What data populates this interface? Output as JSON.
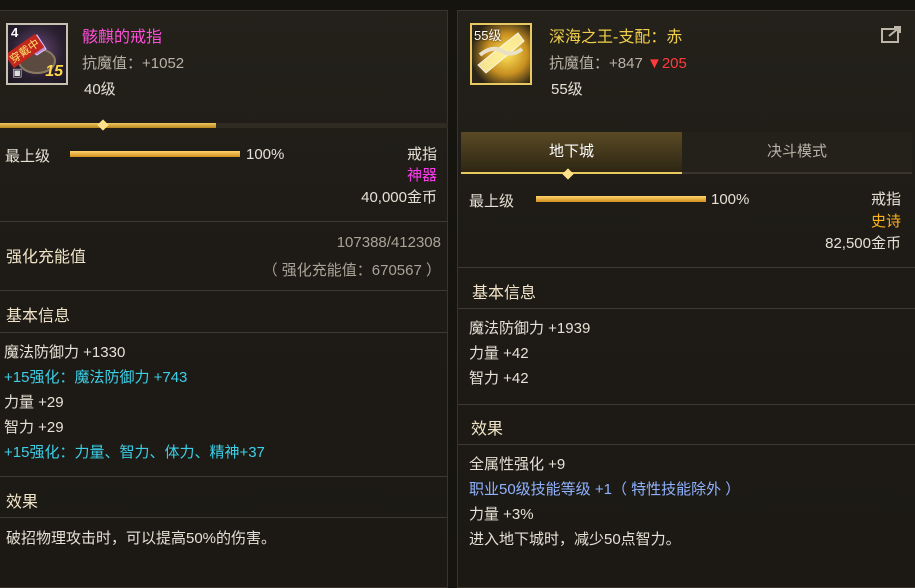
{
  "left": {
    "item_name": "骸麒的戒指",
    "item_name_color": "#ff4fd8",
    "badge_top": "4",
    "badge_equipped": "穿戴中",
    "badge_enhance": "15",
    "magic_resist": "抗魔值：+1052",
    "level": "40级",
    "max_level_label": "最上级",
    "max_level_pct": "100%",
    "max_level_fill": 1.0,
    "slot": "戒指",
    "rarity": "神器",
    "rarity_color": "#ff3bf0",
    "price": "40,000金币",
    "charge_label": "强化充能值",
    "charge_value": "107388/412308",
    "charge_sub": "（ 强化充能值：670567 ）",
    "basic_info_heading": "基本信息",
    "stats": [
      {
        "text": "魔法防御力 +1330",
        "color": "white"
      },
      {
        "text": "+15强化：魔法防御力 +743",
        "color": "cyan"
      },
      {
        "text": "力量 +29",
        "color": "white"
      },
      {
        "text": "智力 +29",
        "color": "white"
      },
      {
        "text": "+15强化：力量、智力、体力、精神+37",
        "color": "cyan"
      }
    ],
    "effect_heading": "效果",
    "effect_text": "破招物理攻击时，可以提高50%的伤害。"
  },
  "right": {
    "item_name": "深海之王-支配：赤",
    "item_name_color": "#f2cf4a",
    "badge_level": "55级",
    "magic_resist": "抗魔值：+847",
    "resist_diff": "▼205",
    "resist_diff_color": "#ff3b3b",
    "level": "55级",
    "share_icon": "share-icon",
    "tabs": [
      "地下城",
      "决斗模式"
    ],
    "active_tab": 0,
    "max_level_label": "最上级",
    "max_level_pct": "100%",
    "max_level_fill": 1.0,
    "slot": "戒指",
    "rarity": "史诗",
    "rarity_color": "#ffb21a",
    "price": "82,500金币",
    "basic_info_heading": "基本信息",
    "stats": [
      {
        "text": "魔法防御力 +1939",
        "color": "white"
      },
      {
        "text": "力量 +42",
        "color": "white"
      },
      {
        "text": "智力 +42",
        "color": "white"
      }
    ],
    "effect_heading": "效果",
    "effects": [
      {
        "text": "全属性强化 +9",
        "color": "white"
      },
      {
        "text": "职业50级技能等级 +1（ 特性技能除外 ）",
        "color": "blue"
      },
      {
        "text": "力量 +3%",
        "color": "white"
      },
      {
        "text": "进入地下城时，减少50点智力。",
        "color": "white"
      }
    ]
  }
}
